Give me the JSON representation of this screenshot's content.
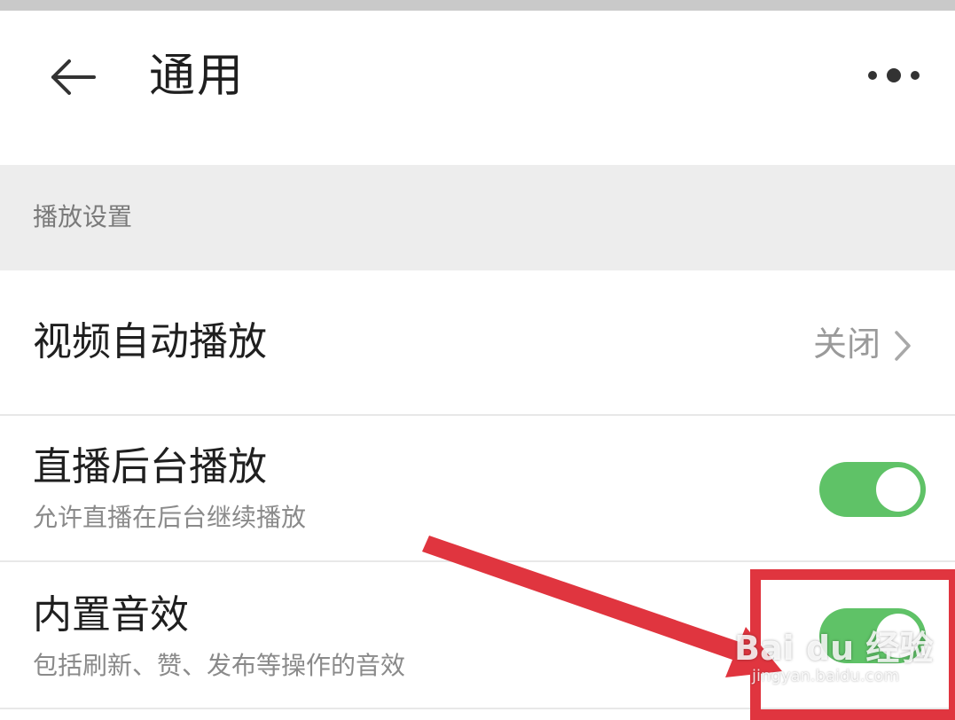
{
  "header": {
    "title": "通用",
    "back_icon": "back-arrow-icon",
    "more_icon": "more-dots-icon"
  },
  "section": {
    "title": "播放设置"
  },
  "rows": [
    {
      "title": "视频自动播放",
      "value": "关闭"
    },
    {
      "title": "直播后台播放",
      "subtitle": "允许直播在后台继续播放",
      "toggle_on": true
    },
    {
      "title": "内置音效",
      "subtitle": "包括刷新、赞、发布等操作的音效",
      "toggle_on": true
    }
  ],
  "colors": {
    "toggle_on": "#5fc267",
    "annotation": "#e0353f"
  },
  "watermark": {
    "main": "Bai du 经验",
    "sub": "jingyan.baidu.com"
  }
}
